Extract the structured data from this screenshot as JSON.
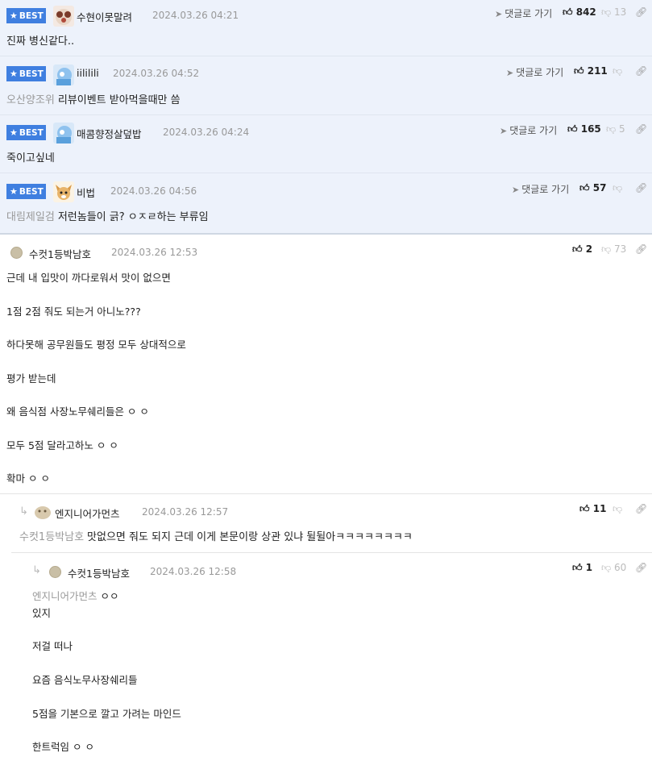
{
  "best_label": "BEST",
  "reply_to_label": "댓글로 가기",
  "best_comments": [
    {
      "nick": "수현이못말려",
      "date": "2024.03.26 04:21",
      "up": "842",
      "down": "13",
      "mention": "",
      "text": "진짜 병신같다.."
    },
    {
      "nick": "iililili",
      "date": "2024.03.26 04:52",
      "up": "211",
      "down": "",
      "mention": "오산양조위",
      "text": "리뷰이벤트 받아먹을때만 씀"
    },
    {
      "nick": "매콤향정살덮밥",
      "date": "2024.03.26 04:24",
      "up": "165",
      "down": "5",
      "mention": "",
      "text": "죽이고싶네"
    },
    {
      "nick": "비법",
      "date": "2024.03.26 04:56",
      "up": "57",
      "down": "",
      "mention": "대림제일검",
      "text": "저런놈들이 긁? ㅇㅈㄹ하는 부류임"
    }
  ],
  "main_comment": {
    "nick": "수컷1등박남호",
    "date": "2024.03.26 12:53",
    "up": "2",
    "down": "73",
    "lines": [
      "근데 내 입맛이 까다로워서 맛이 없으면",
      "1점 2점 줘도 되는거 아니노???",
      "하다못해 공무원들도 평정 모두 상대적으로",
      "평가 받는데",
      "왜 음식점 사장노무쉐리들은 ㅇ ㅇ",
      "모두 5점 달라고하노 ㅇ ㅇ",
      "확마 ㅇ ㅇ"
    ]
  },
  "reply_1": {
    "nick": "엔지니어가먼츠",
    "date": "2024.03.26 12:57",
    "up": "11",
    "down": "",
    "mention": "수컷1등박남호",
    "text": "맛없으면 줘도 되지 근데 이게 본문이랑 상관 있냐 뒬뒬아ㅋㅋㅋㅋㅋㅋㅋㅋ"
  },
  "reply_2": {
    "nick": "수컷1등박남호",
    "date": "2024.03.26 12:58",
    "up": "1",
    "down": "60",
    "mention": "엔지니어가먼츠",
    "first_line": "ㅇㅇ",
    "lines": [
      "있지",
      "저걸 떠나",
      "요즘 음식노무사장쉐리들",
      "5점을 기본으로 깔고 가려는 마인드",
      "한트럭임 ㅇ ㅇ"
    ]
  },
  "colors": {
    "badge": "#3f7fe0",
    "best_bg": "#edf2fb",
    "muted": "#999999"
  }
}
